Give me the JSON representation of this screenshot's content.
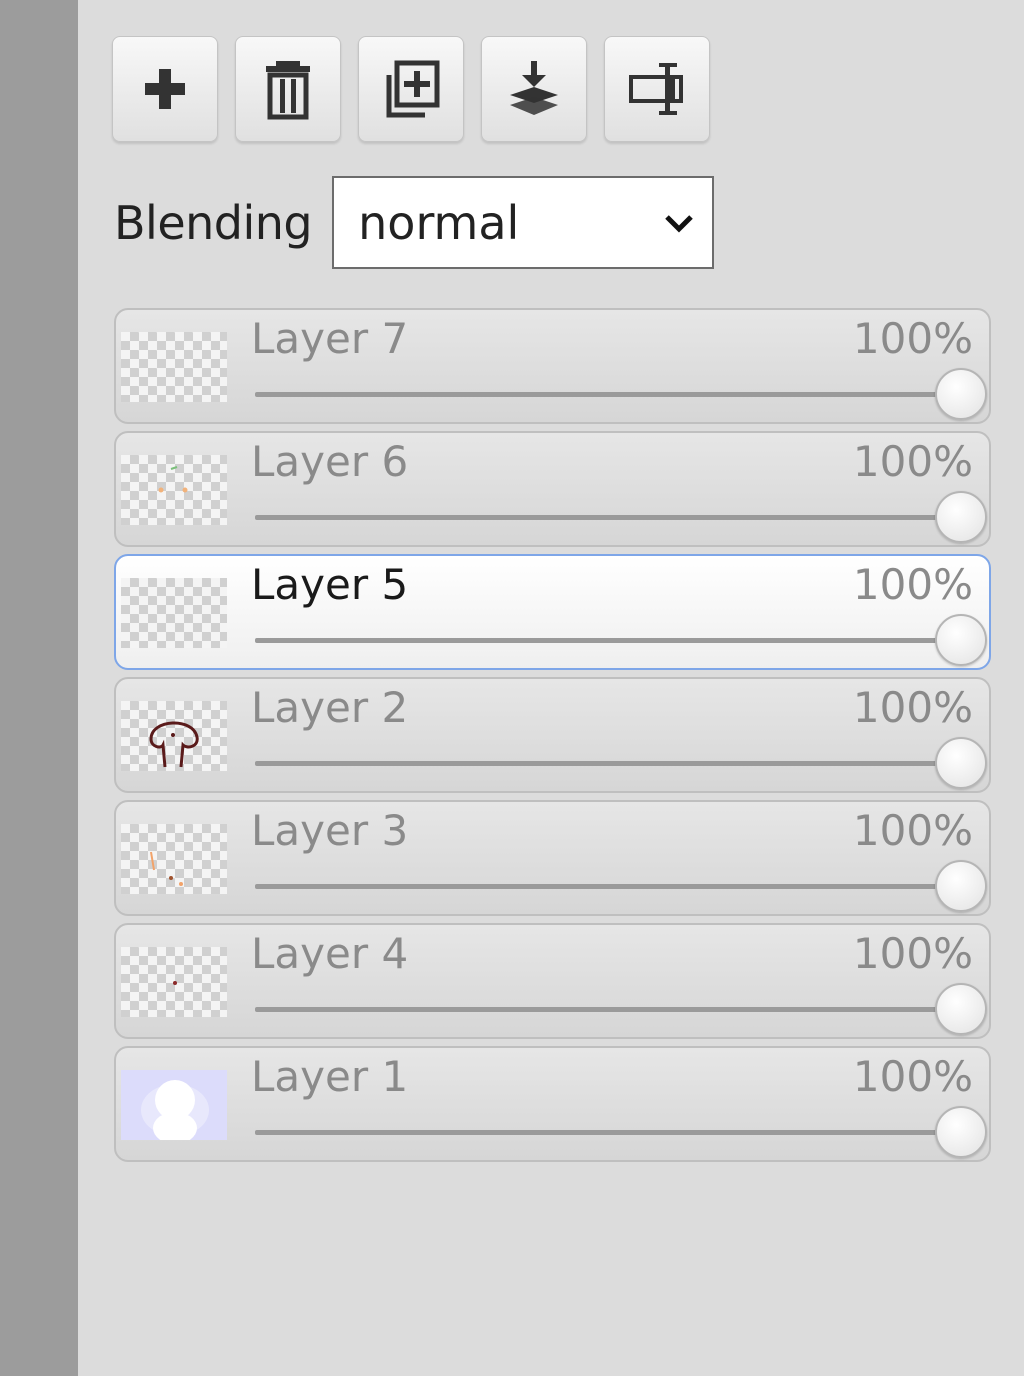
{
  "toolbar": {
    "buttons": [
      {
        "icon": "plus-icon"
      },
      {
        "icon": "trash-icon"
      },
      {
        "icon": "duplicate-icon"
      },
      {
        "icon": "merge-down-icon"
      },
      {
        "icon": "rename-icon"
      }
    ]
  },
  "blending": {
    "label": "Blending",
    "value": "normal"
  },
  "layers": [
    {
      "name": "Layer 7",
      "opacity": "100%",
      "opacity_fraction": 1.0,
      "active": false,
      "thumb": "empty"
    },
    {
      "name": "Layer 6",
      "opacity": "100%",
      "opacity_fraction": 1.0,
      "active": false,
      "thumb": "dots"
    },
    {
      "name": "Layer 5",
      "opacity": "100%",
      "opacity_fraction": 1.0,
      "active": true,
      "thumb": "empty"
    },
    {
      "name": "Layer 2",
      "opacity": "100%",
      "opacity_fraction": 1.0,
      "active": false,
      "thumb": "sketch"
    },
    {
      "name": "Layer 3",
      "opacity": "100%",
      "opacity_fraction": 1.0,
      "active": false,
      "thumb": "orange-marks"
    },
    {
      "name": "Layer 4",
      "opacity": "100%",
      "opacity_fraction": 1.0,
      "active": false,
      "thumb": "dot"
    },
    {
      "name": "Layer 1",
      "opacity": "100%",
      "opacity_fraction": 1.0,
      "active": false,
      "thumb": "background"
    }
  ],
  "colors": {
    "active_border": "#7ea6e8",
    "panel_bg": "#dcdcdc",
    "side_strip": "#9c9c9c"
  }
}
